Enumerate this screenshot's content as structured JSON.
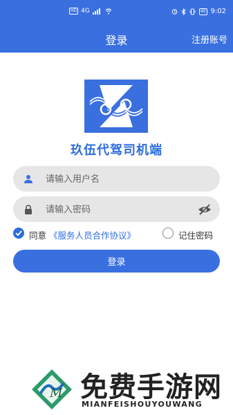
{
  "status_bar": {
    "left_chip": "HD",
    "network": "4G",
    "hd_chip": "HD",
    "battery": "40",
    "time": "9:02"
  },
  "nav": {
    "title": "登录",
    "register_label": "注册账号"
  },
  "app": {
    "name": "玖伍代驾司机端"
  },
  "form": {
    "username_placeholder": "请输入用户名",
    "username_value": "",
    "password_placeholder": "请输入密码",
    "password_value": "",
    "agree_prefix": "同意",
    "agreement_link": "《服务人员合作协议》",
    "agree_checked": true,
    "remember_label": "记住密码",
    "remember_checked": false,
    "login_label": "登录"
  },
  "watermark": {
    "title": "免费手游网",
    "subtitle": "MIANFEISHOUYOUWANG"
  },
  "colors": {
    "primary": "#3a6fe0",
    "link": "#2c6de0",
    "field_bg": "#e6e6e6"
  },
  "icons": [
    "user-icon",
    "lock-icon",
    "eye-off-icon",
    "check-icon",
    "wifi-icon",
    "bluetooth-icon",
    "alarm-icon",
    "vibrate-icon",
    "battery-icon"
  ]
}
